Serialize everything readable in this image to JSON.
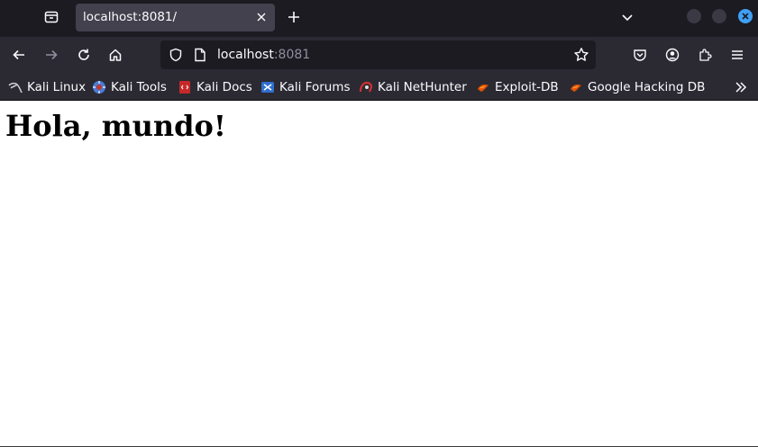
{
  "tab": {
    "title": "localhost:8081/"
  },
  "urlbar": {
    "host": "localhost",
    "port": ":8081"
  },
  "bookmarks": [
    {
      "label": "Kali Linux",
      "icon": "kali-dragon-icon"
    },
    {
      "label": "Kali Tools",
      "icon": "kali-tools-icon"
    },
    {
      "label": "Kali Docs",
      "icon": "kali-docs-icon"
    },
    {
      "label": "Kali Forums",
      "icon": "kali-forums-icon"
    },
    {
      "label": "Kali NetHunter",
      "icon": "nethunter-icon"
    },
    {
      "label": "Exploit-DB",
      "icon": "exploit-db-icon"
    },
    {
      "label": "Google Hacking DB",
      "icon": "ghdb-icon"
    }
  ],
  "page": {
    "heading": "Hola, mundo!"
  },
  "colors": {
    "tabstrip": "#1c1b22",
    "toolbar": "#2b2a33",
    "active_tab": "#42414d",
    "accent_close": "#3fa0f6"
  }
}
